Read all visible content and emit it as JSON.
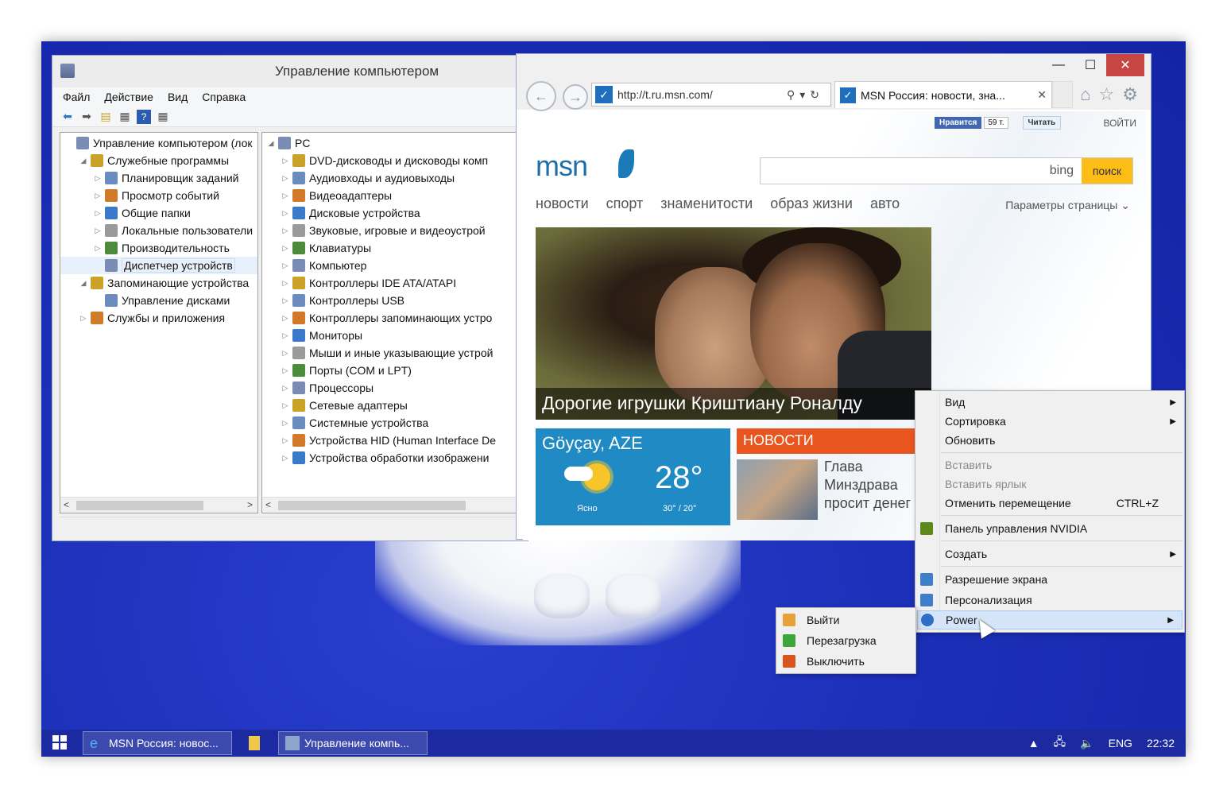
{
  "computer_management": {
    "title": "Управление компьютером",
    "menu": [
      "Файл",
      "Действие",
      "Вид",
      "Справка"
    ],
    "left_tree": [
      {
        "label": "Управление компьютером (лок",
        "arrow": "",
        "indent": 0
      },
      {
        "label": "Служебные программы",
        "arrow": "◢",
        "indent": 1
      },
      {
        "label": "Планировщик заданий",
        "arrow": "▷",
        "indent": 2
      },
      {
        "label": "Просмотр событий",
        "arrow": "▷",
        "indent": 2
      },
      {
        "label": "Общие папки",
        "arrow": "▷",
        "indent": 2
      },
      {
        "label": "Локальные пользователи",
        "arrow": "▷",
        "indent": 2
      },
      {
        "label": "Производительность",
        "arrow": "▷",
        "indent": 2
      },
      {
        "label": "Диспетчер устройств",
        "arrow": "",
        "indent": 2,
        "selected": true
      },
      {
        "label": "Запоминающие устройства",
        "arrow": "◢",
        "indent": 1
      },
      {
        "label": "Управление дисками",
        "arrow": "",
        "indent": 2
      },
      {
        "label": "Службы и приложения",
        "arrow": "▷",
        "indent": 1
      }
    ],
    "right_tree": [
      {
        "label": "PC",
        "arrow": "◢",
        "indent": 0
      },
      {
        "label": "DVD-дисководы и дисководы комп",
        "arrow": "▷",
        "indent": 1
      },
      {
        "label": "Аудиовходы и аудиовыходы",
        "arrow": "▷",
        "indent": 1
      },
      {
        "label": "Видеоадаптеры",
        "arrow": "▷",
        "indent": 1
      },
      {
        "label": "Дисковые устройства",
        "arrow": "▷",
        "indent": 1
      },
      {
        "label": "Звуковые, игровые и видеоустрой",
        "arrow": "▷",
        "indent": 1
      },
      {
        "label": "Клавиатуры",
        "arrow": "▷",
        "indent": 1
      },
      {
        "label": "Компьютер",
        "arrow": "▷",
        "indent": 1
      },
      {
        "label": "Контроллеры IDE ATA/ATAPI",
        "arrow": "▷",
        "indent": 1
      },
      {
        "label": "Контроллеры USB",
        "arrow": "▷",
        "indent": 1
      },
      {
        "label": "Контроллеры запоминающих устро",
        "arrow": "▷",
        "indent": 1
      },
      {
        "label": "Мониторы",
        "arrow": "▷",
        "indent": 1
      },
      {
        "label": "Мыши и иные указывающие устрой",
        "arrow": "▷",
        "indent": 1
      },
      {
        "label": "Порты (COM и LPT)",
        "arrow": "▷",
        "indent": 1
      },
      {
        "label": "Процессоры",
        "arrow": "▷",
        "indent": 1
      },
      {
        "label": "Сетевые адаптеры",
        "arrow": "▷",
        "indent": 1
      },
      {
        "label": "Системные устройства",
        "arrow": "▷",
        "indent": 1
      },
      {
        "label": "Устройства HID (Human Interface De",
        "arrow": "▷",
        "indent": 1
      },
      {
        "label": "Устройства обработки изображени",
        "arrow": "▷",
        "indent": 1
      }
    ]
  },
  "ie": {
    "url": "http://t.ru.msn.com/",
    "tab_title": "MSN Россия: новости, зна...",
    "page": {
      "fb_like": "Нравится",
      "fb_count": "59 т.",
      "tw": "Читать",
      "login": "ВОЙТИ",
      "logo": "msn",
      "bing": "bing",
      "search_button": "поиск",
      "nav": [
        "новости",
        "спорт",
        "знаменитости",
        "образ жизни",
        "авто"
      ],
      "page_params": "Параметры страницы",
      "hero_caption": "Дорогие игрушки Криштиану Роналду",
      "weather": {
        "city": "Göyçay, AZE",
        "temp": "28°",
        "condition": "Ясно",
        "range": "30° / 20°"
      },
      "news_header": "НОВОСТИ",
      "news_text": [
        "Глава",
        "Минздрава",
        "просит денег"
      ]
    }
  },
  "context_menu": {
    "items": [
      {
        "label": "Вид",
        "submenu": true,
        "disabled": false
      },
      {
        "label": "Сортировка",
        "submenu": true,
        "disabled": false
      },
      {
        "label": "Обновить",
        "submenu": false,
        "disabled": false
      },
      {
        "label": "Вставить",
        "submenu": false,
        "disabled": true
      },
      {
        "label": "Вставить ярлык",
        "submenu": false,
        "disabled": true
      },
      {
        "label": "Отменить перемещение",
        "shortcut": "CTRL+Z",
        "submenu": false,
        "disabled": false
      },
      {
        "label": "Панель управления NVIDIA",
        "submenu": false,
        "disabled": false
      },
      {
        "label": "Создать",
        "submenu": true,
        "disabled": false
      },
      {
        "label": "Разрешение экрана",
        "submenu": false,
        "disabled": false
      },
      {
        "label": "Персонализация",
        "submenu": false,
        "disabled": false
      },
      {
        "label": "Power",
        "submenu": true,
        "disabled": false,
        "highlighted": true
      }
    ]
  },
  "power_submenu": {
    "items": [
      "Выйти",
      "Перезагрузка",
      "Выключить"
    ]
  },
  "taskbar": {
    "buttons": [
      "MSN Россия: новос...",
      "Управление компь..."
    ],
    "lang": "ENG",
    "time": "22:32"
  },
  "colors": {
    "desktop": "#1b2fb8",
    "taskbar": "#1b2aa0",
    "msn_blue": "#1f6fa8",
    "bing_yellow": "#fbbd16",
    "weather_tile": "#1f8ac4",
    "news_tile": "#e8551f"
  }
}
